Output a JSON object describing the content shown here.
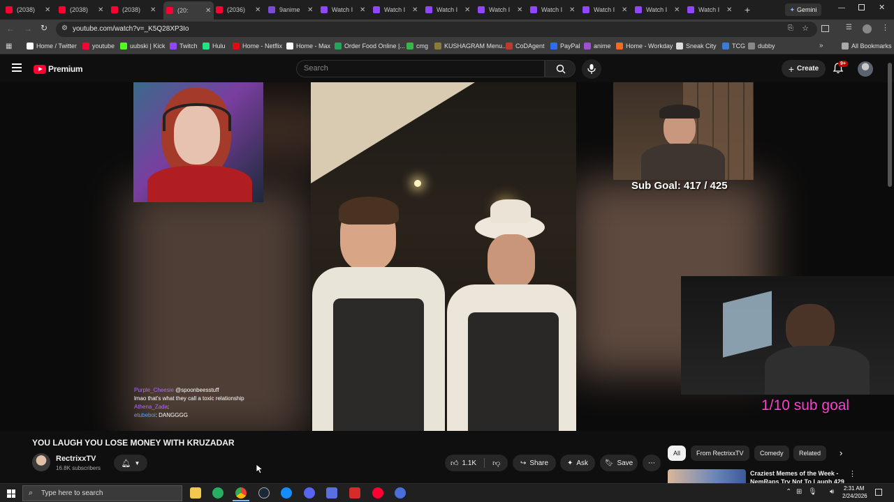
{
  "tabs": [
    {
      "label": "(2038)",
      "favicon": "youtube-icon"
    },
    {
      "label": "(2038)",
      "favicon": "youtube-icon"
    },
    {
      "label": "(2038)",
      "favicon": "youtube-icon"
    },
    {
      "label": "(20:",
      "favicon": "youtube-icon",
      "active": true
    },
    {
      "label": "(2036)",
      "favicon": "youtube-icon"
    },
    {
      "label": "9anime",
      "favicon": "anime-icon"
    },
    {
      "label": "Watch I",
      "favicon": "twitch-icon"
    },
    {
      "label": "Watch I",
      "favicon": "twitch-icon"
    },
    {
      "label": "Watch I",
      "favicon": "twitch-icon"
    },
    {
      "label": "Watch I",
      "favicon": "twitch-icon"
    },
    {
      "label": "Watch I",
      "favicon": "twitch-icon"
    },
    {
      "label": "Watch I",
      "favicon": "twitch-icon"
    },
    {
      "label": "Watch I",
      "favicon": "twitch-icon"
    },
    {
      "label": "Watch I",
      "favicon": "twitch-icon"
    }
  ],
  "gemini_label": "Gemini",
  "url": "youtube.com/watch?v=_K5Q28XP3Io",
  "bookmarks": [
    "Home / Twitter",
    "youtube",
    "uubski | Kick",
    "Twitch",
    "Hulu",
    "Home - Netflix",
    "Home - Max",
    "Order Food Online |...",
    "cmg",
    "KUSHAGRAM Menu...",
    "CoDAgent",
    "PayPal",
    "anime",
    "Home - Workday",
    "Sneak City",
    "TCG",
    "dubby"
  ],
  "all_bookmarks": "All Bookmarks",
  "yt": {
    "logo_text": "Premium",
    "search_placeholder": "Search",
    "create_label": "Create",
    "notif_badge": "9+"
  },
  "overlay": {
    "sub_goal": "Sub Goal: 417 / 425",
    "sub_goal_2": "1/10 sub goal",
    "chat": [
      {
        "user": "Purple_Cheesie",
        "msg": "@spoonbeesstuff"
      },
      {
        "user": "",
        "msg": "lmao that's what they call a toxic relationship"
      },
      {
        "user": "Athena_Zada",
        "msg": ":"
      },
      {
        "user": "etubeboi",
        "msg": "DANGGGG"
      }
    ]
  },
  "video_title": "YOU LAUGH YOU LOSE MONEY WITH KRUZADAR",
  "channel": {
    "name": "RectrixxTV",
    "subs": "16.8K subscribers"
  },
  "actions": {
    "likes": "1.1K",
    "share": "Share",
    "ask": "Ask",
    "save": "Save"
  },
  "chips": [
    "All",
    "From RectrixxTV",
    "Comedy",
    "Related"
  ],
  "rec": {
    "title": "Craziest Memes of the Week -",
    "subtitle": "NemRaps Try Not To Laugh 429"
  },
  "taskbar": {
    "search_placeholder": "Type here to search",
    "time": "2:31 AM",
    "date": "2/24/2026"
  },
  "colors": {
    "youtube_red": "#ff0033",
    "twitch_purple": "#9146ff",
    "sub_goal_pink": "#ff3fd2"
  }
}
